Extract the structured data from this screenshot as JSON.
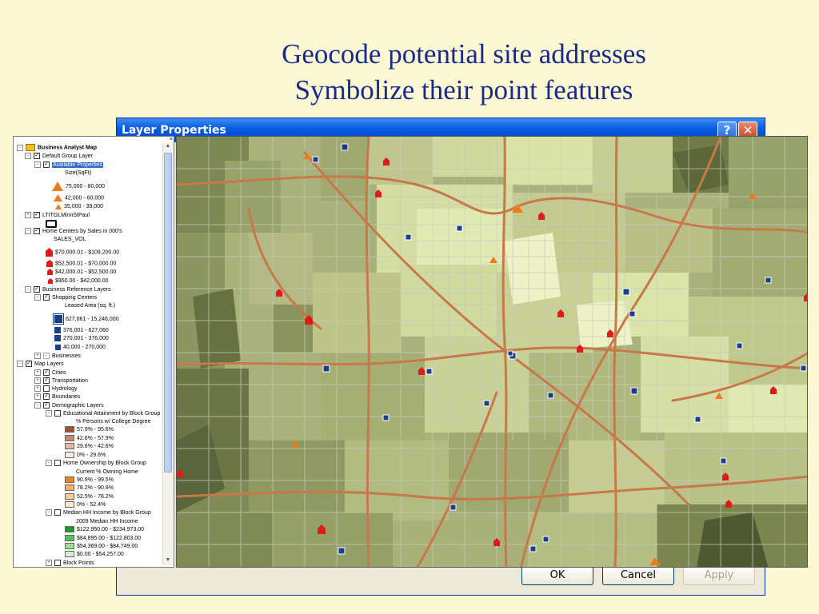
{
  "slide": {
    "title_line1": "Geocode potential site addresses",
    "title_line2": "Symbolize their point features"
  },
  "dialog": {
    "title": "Layer Properties",
    "help_label": "?",
    "close_label": "✕",
    "buttons": {
      "ok": "OK",
      "cancel": "Cancel",
      "apply": "Apply"
    }
  },
  "toc": {
    "close_label": "×",
    "root": "Business Analyst Map",
    "default_group": "Default Group Layer",
    "available_properties": "Available Properties",
    "size_header": "Size(SqFt)",
    "size_classes": [
      "75,000 - 80,000",
      "42,000 - 60,000",
      "35,000 - 39,000"
    ],
    "ltitgl": "LTITGLMinnStPaul",
    "home_centers": "Home Centers by Sales in 000's",
    "sales_field": "SALES_VOL",
    "sales_classes": [
      "$70,000.01 - $109,200.00",
      "$52,500.01 - $70,000.00",
      "$42,000.01 - $52,500.00",
      "$950.00 - $42,000.00"
    ],
    "business_reference": "Business Reference Layers",
    "shopping_centers": "Shopping Centers",
    "leased_area": "Leased Area (sq. ft.)",
    "leased_classes": [
      "627,061 - 15,246,000",
      "376,001 - 627,060",
      "270,001 - 376,000",
      "40,000 - 270,000"
    ],
    "businesses": "Businesses",
    "map_layers": "Map Layers",
    "cities": "Cities",
    "transportation": "Transportation",
    "hydrology": "Hydrology",
    "boundaries": "Boundaries",
    "demographic_layers": "Demographic Layers",
    "education": "Educational Attainment by Block Group",
    "education_field": "% Persons w/ College Degree",
    "education_classes": [
      {
        "label": "57.9% - 95.6%",
        "color": "#a0522d"
      },
      {
        "label": "42.6% - 57.9%",
        "color": "#c88a6e"
      },
      {
        "label": "29.6% - 42.6%",
        "color": "#e4b9a4"
      },
      {
        "label": "0% - 29.6%",
        "color": "#f8e8de"
      }
    ],
    "home_ownership": "Home Ownership by Block Group",
    "ownership_field": "Current % Owning Home",
    "ownership_classes": [
      {
        "label": "90.9% - 99.5%",
        "color": "#e8861f"
      },
      {
        "label": "78.2% - 90.9%",
        "color": "#f4ae62"
      },
      {
        "label": "52.5% - 78.2%",
        "color": "#f8cb95"
      },
      {
        "label": "0% - 52.4%",
        "color": "#fdeacc"
      }
    ],
    "median_income": "Median HH Income by Block Group",
    "income_field": "2009 Median HH Income",
    "income_classes": [
      {
        "label": "$122,950.00 - $234,973.00",
        "color": "#1a9c2a"
      },
      {
        "label": "$84,895.00 - $122,803.00",
        "color": "#55c255"
      },
      {
        "label": "$54,369.00 - $84,749.00",
        "color": "#9fdc95"
      },
      {
        "label": "$0.00 - $54,257.00",
        "color": "#d9f3d2"
      }
    ],
    "block_points": "Block Points"
  },
  "colors": {
    "title_text": "#1a2a8c",
    "slide_bg": "#fbf8d2",
    "highway": "#c8784a",
    "local_road": "#c9c9c0",
    "home_center": "#e01b1b",
    "available_property": "#f07a1a",
    "shopping_center": "#1c3f8a"
  }
}
